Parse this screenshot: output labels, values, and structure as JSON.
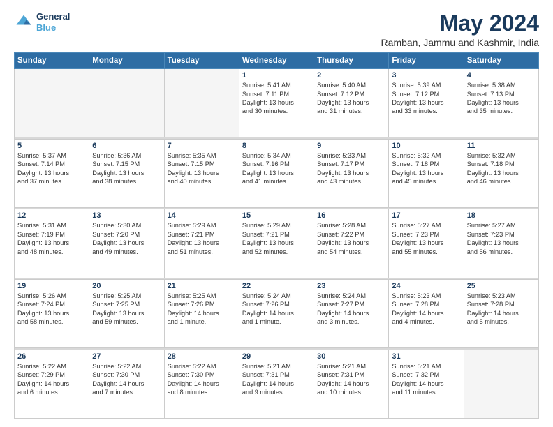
{
  "header": {
    "logo_line1": "General",
    "logo_line2": "Blue",
    "title": "May 2024",
    "subtitle": "Ramban, Jammu and Kashmir, India"
  },
  "weekdays": [
    "Sunday",
    "Monday",
    "Tuesday",
    "Wednesday",
    "Thursday",
    "Friday",
    "Saturday"
  ],
  "weeks": [
    [
      {
        "day": "",
        "info": ""
      },
      {
        "day": "",
        "info": ""
      },
      {
        "day": "",
        "info": ""
      },
      {
        "day": "1",
        "info": "Sunrise: 5:41 AM\nSunset: 7:11 PM\nDaylight: 13 hours\nand 30 minutes."
      },
      {
        "day": "2",
        "info": "Sunrise: 5:40 AM\nSunset: 7:12 PM\nDaylight: 13 hours\nand 31 minutes."
      },
      {
        "day": "3",
        "info": "Sunrise: 5:39 AM\nSunset: 7:12 PM\nDaylight: 13 hours\nand 33 minutes."
      },
      {
        "day": "4",
        "info": "Sunrise: 5:38 AM\nSunset: 7:13 PM\nDaylight: 13 hours\nand 35 minutes."
      }
    ],
    [
      {
        "day": "5",
        "info": "Sunrise: 5:37 AM\nSunset: 7:14 PM\nDaylight: 13 hours\nand 37 minutes."
      },
      {
        "day": "6",
        "info": "Sunrise: 5:36 AM\nSunset: 7:15 PM\nDaylight: 13 hours\nand 38 minutes."
      },
      {
        "day": "7",
        "info": "Sunrise: 5:35 AM\nSunset: 7:15 PM\nDaylight: 13 hours\nand 40 minutes."
      },
      {
        "day": "8",
        "info": "Sunrise: 5:34 AM\nSunset: 7:16 PM\nDaylight: 13 hours\nand 41 minutes."
      },
      {
        "day": "9",
        "info": "Sunrise: 5:33 AM\nSunset: 7:17 PM\nDaylight: 13 hours\nand 43 minutes."
      },
      {
        "day": "10",
        "info": "Sunrise: 5:32 AM\nSunset: 7:18 PM\nDaylight: 13 hours\nand 45 minutes."
      },
      {
        "day": "11",
        "info": "Sunrise: 5:32 AM\nSunset: 7:18 PM\nDaylight: 13 hours\nand 46 minutes."
      }
    ],
    [
      {
        "day": "12",
        "info": "Sunrise: 5:31 AM\nSunset: 7:19 PM\nDaylight: 13 hours\nand 48 minutes."
      },
      {
        "day": "13",
        "info": "Sunrise: 5:30 AM\nSunset: 7:20 PM\nDaylight: 13 hours\nand 49 minutes."
      },
      {
        "day": "14",
        "info": "Sunrise: 5:29 AM\nSunset: 7:21 PM\nDaylight: 13 hours\nand 51 minutes."
      },
      {
        "day": "15",
        "info": "Sunrise: 5:29 AM\nSunset: 7:21 PM\nDaylight: 13 hours\nand 52 minutes."
      },
      {
        "day": "16",
        "info": "Sunrise: 5:28 AM\nSunset: 7:22 PM\nDaylight: 13 hours\nand 54 minutes."
      },
      {
        "day": "17",
        "info": "Sunrise: 5:27 AM\nSunset: 7:23 PM\nDaylight: 13 hours\nand 55 minutes."
      },
      {
        "day": "18",
        "info": "Sunrise: 5:27 AM\nSunset: 7:23 PM\nDaylight: 13 hours\nand 56 minutes."
      }
    ],
    [
      {
        "day": "19",
        "info": "Sunrise: 5:26 AM\nSunset: 7:24 PM\nDaylight: 13 hours\nand 58 minutes."
      },
      {
        "day": "20",
        "info": "Sunrise: 5:25 AM\nSunset: 7:25 PM\nDaylight: 13 hours\nand 59 minutes."
      },
      {
        "day": "21",
        "info": "Sunrise: 5:25 AM\nSunset: 7:26 PM\nDaylight: 14 hours\nand 1 minute."
      },
      {
        "day": "22",
        "info": "Sunrise: 5:24 AM\nSunset: 7:26 PM\nDaylight: 14 hours\nand 1 minute."
      },
      {
        "day": "23",
        "info": "Sunrise: 5:24 AM\nSunset: 7:27 PM\nDaylight: 14 hours\nand 3 minutes."
      },
      {
        "day": "24",
        "info": "Sunrise: 5:23 AM\nSunset: 7:28 PM\nDaylight: 14 hours\nand 4 minutes."
      },
      {
        "day": "25",
        "info": "Sunrise: 5:23 AM\nSunset: 7:28 PM\nDaylight: 14 hours\nand 5 minutes."
      }
    ],
    [
      {
        "day": "26",
        "info": "Sunrise: 5:22 AM\nSunset: 7:29 PM\nDaylight: 14 hours\nand 6 minutes."
      },
      {
        "day": "27",
        "info": "Sunrise: 5:22 AM\nSunset: 7:30 PM\nDaylight: 14 hours\nand 7 minutes."
      },
      {
        "day": "28",
        "info": "Sunrise: 5:22 AM\nSunset: 7:30 PM\nDaylight: 14 hours\nand 8 minutes."
      },
      {
        "day": "29",
        "info": "Sunrise: 5:21 AM\nSunset: 7:31 PM\nDaylight: 14 hours\nand 9 minutes."
      },
      {
        "day": "30",
        "info": "Sunrise: 5:21 AM\nSunset: 7:31 PM\nDaylight: 14 hours\nand 10 minutes."
      },
      {
        "day": "31",
        "info": "Sunrise: 5:21 AM\nSunset: 7:32 PM\nDaylight: 14 hours\nand 11 minutes."
      },
      {
        "day": "",
        "info": ""
      }
    ]
  ]
}
